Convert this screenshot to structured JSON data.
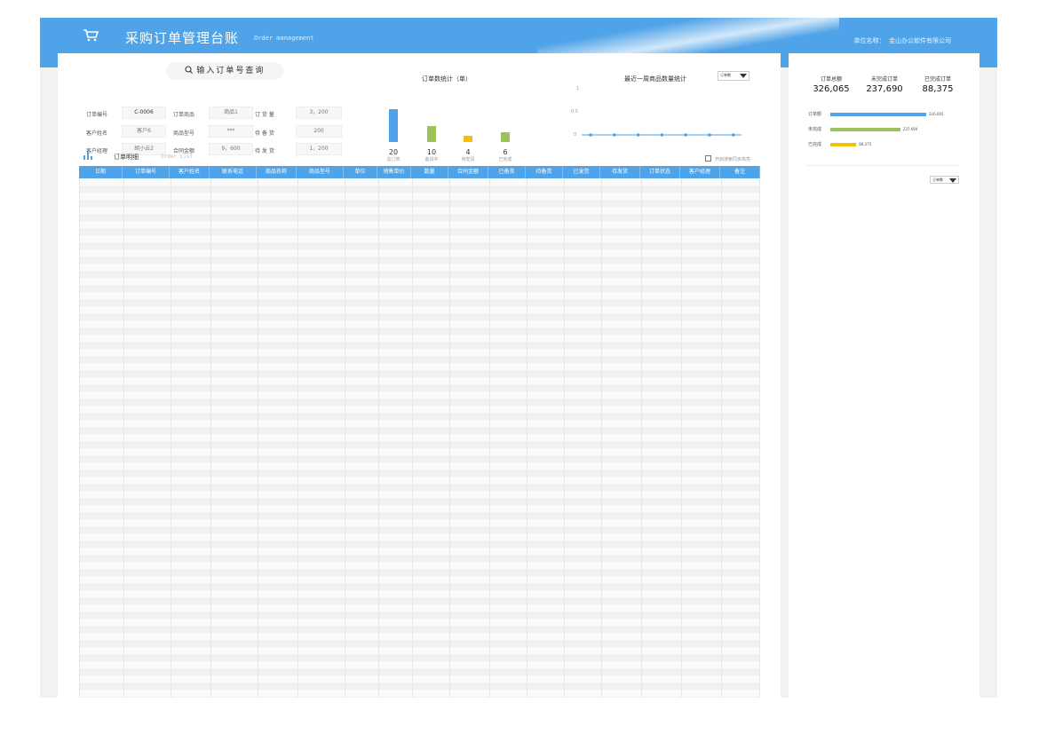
{
  "header": {
    "title": "采购订单管理台账",
    "subtitle": "Order management",
    "unit_label": "单位名称：",
    "unit_name": "金山办公软件有限公司"
  },
  "search": {
    "label": "输入订单号查询"
  },
  "form": {
    "order_no_label": "订单编号",
    "order_no": "C-0006",
    "product_label": "订单商品",
    "product": "商品1",
    "qty_label": "订 货 量",
    "qty": "3，200",
    "customer_label": "客户姓名",
    "customer": "客户6",
    "model_label": "商品型号",
    "model": "***",
    "ready_label": "待 备 货",
    "ready": "200",
    "manager_label": "客户经理",
    "manager": "胡小云2",
    "amount_label": "合同金额",
    "amount": "9，600",
    "ship_label": "待 发 货",
    "ship": "1，200"
  },
  "order_chart": {
    "title": "订单数统计（单）",
    "items": [
      {
        "value": "20",
        "label": "总订单",
        "n": 20,
        "color": "#4fa3e8"
      },
      {
        "value": "10",
        "label": "备货中",
        "n": 10,
        "color": "#9bc25b"
      },
      {
        "value": "4",
        "label": "待发货",
        "n": 4,
        "color": "#f5c000"
      },
      {
        "value": "6",
        "label": "已完成",
        "n": 6,
        "color": "#9bc25b"
      }
    ]
  },
  "week_chart": {
    "title": "最近一周商品数量统计",
    "select": "订单数",
    "ticks": [
      "1",
      "0.5",
      "0"
    ],
    "values": [
      0,
      0,
      0,
      0,
      0,
      0,
      0
    ]
  },
  "list": {
    "title": "订单明细",
    "subtitle": "Order List",
    "checkbox": "开启搜索同步高亮"
  },
  "columns": [
    "日期",
    "订单编号",
    "客户姓名",
    "联系电话",
    "商品名称",
    "商品型号",
    "单位",
    "销售单价",
    "数量",
    "合同金额",
    "已备货",
    "待备货",
    "已发货",
    "待发货",
    "订单状态",
    "客户经理",
    "备注"
  ],
  "summary": {
    "stats": [
      {
        "label": "订单总额",
        "value": "326,065"
      },
      {
        "label": "未完成订单",
        "value": "237,690"
      },
      {
        "label": "已完成订单",
        "value": "88,375"
      }
    ],
    "bars": [
      {
        "label": "订单额",
        "value": "326,065",
        "fraction": 1.0,
        "color": "#4fa3e8"
      },
      {
        "label": "未完成",
        "value": "237,690",
        "fraction": 0.729,
        "color": "#9bc25b"
      },
      {
        "label": "已完成",
        "value": "88,375",
        "fraction": 0.271,
        "color": "#f5c000"
      }
    ],
    "select": "订单数"
  }
}
